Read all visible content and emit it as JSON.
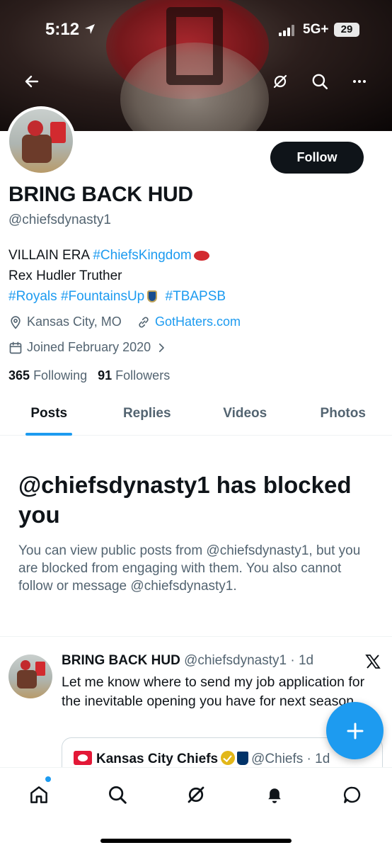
{
  "status_bar": {
    "time": "5:12",
    "network": "5G+",
    "battery": "29"
  },
  "profile": {
    "display_name": "BRING BACK HUD",
    "handle": "@chiefsdynasty1",
    "follow_label": "Follow",
    "bio": {
      "line1_text": "VILLAIN ERA ",
      "line1_hashtag": "#ChiefsKingdom",
      "line2_text": "Rex Hudler Truther",
      "line3_hashtag1": "#Royals",
      "line3_hashtag2": "#FountainsUp",
      "line3_hashtag3": "#TBAPSB"
    },
    "location": "Kansas City, MO",
    "website": "GotHaters.com",
    "joined": "Joined February 2020",
    "following_count": "365",
    "following_label": "Following",
    "followers_count": "91",
    "followers_label": "Followers"
  },
  "tabs": [
    {
      "label": "Posts",
      "active": true
    },
    {
      "label": "Replies",
      "active": false
    },
    {
      "label": "Videos",
      "active": false
    },
    {
      "label": "Photos",
      "active": false
    }
  ],
  "blocked_notice": {
    "title": "@chiefsdynasty1 has blocked you",
    "body": "You can view public posts from @chiefsdynasty1, but you are blocked from engaging with them. You also cannot follow or message @chiefsdynasty1."
  },
  "tweet": {
    "author_name": "BRING BACK HUD",
    "author_handle": "@chiefsdynasty1",
    "separator": " · ",
    "age": "1d",
    "text": "Let me know where to send my job application for the inevitable opening you have for next season.",
    "quote": {
      "author_name": "Kansas City Chiefs",
      "author_handle": "@Chiefs",
      "separator": " · ",
      "age": "1d"
    }
  },
  "icons": {
    "back": "arrow-left-icon",
    "grok": "grok-icon",
    "search": "search-icon",
    "more": "more-horizontal-icon",
    "location": "location-pin-icon",
    "link": "link-icon",
    "calendar": "calendar-icon",
    "compose": "plus-icon",
    "nav": [
      "home-icon",
      "search-icon",
      "grok-icon",
      "bell-icon",
      "message-icon"
    ]
  },
  "colors": {
    "accent": "#1d9bf0",
    "text_primary": "#0f1419",
    "text_secondary": "#536471",
    "follow_bg": "#0f1419"
  }
}
